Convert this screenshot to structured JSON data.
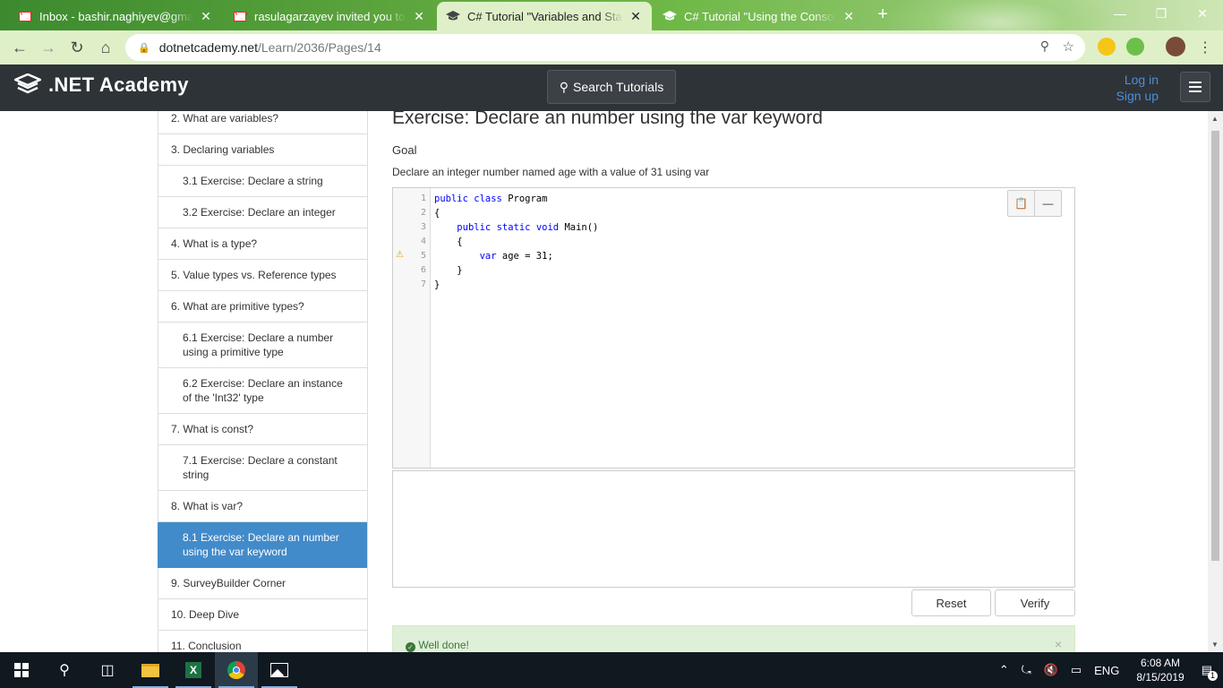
{
  "browser": {
    "tabs": [
      {
        "title": "Inbox - bashir.naghiyev@gmail.com",
        "icon": "gmail-icon",
        "active": false
      },
      {
        "title": "rasulagarzayev invited you to Co",
        "icon": "gmail-icon",
        "active": false
      },
      {
        "title": "C# Tutorial \"Variables and Standa",
        "icon": "graduation-cap-icon",
        "active": true
      },
      {
        "title": "C# Tutorial \"Using the Console\" -",
        "icon": "graduation-cap-icon",
        "active": false
      }
    ],
    "url_host": "dotnetcademy.net",
    "url_path": "/Learn/2036/Pages/14"
  },
  "header": {
    "logo_text": ".NET Academy",
    "search_label": "Search Tutorials",
    "login_label": "Log in",
    "signup_label": "Sign up"
  },
  "sidebar": {
    "items": [
      {
        "label": "2. What are variables?",
        "sub": false,
        "active": false
      },
      {
        "label": "3. Declaring variables",
        "sub": false,
        "active": false
      },
      {
        "label": "3.1 Exercise: Declare a string",
        "sub": true,
        "active": false
      },
      {
        "label": "3.2 Exercise: Declare an integer",
        "sub": true,
        "active": false
      },
      {
        "label": "4. What is a type?",
        "sub": false,
        "active": false
      },
      {
        "label": "5. Value types vs. Reference types",
        "sub": false,
        "active": false
      },
      {
        "label": "6. What are primitive types?",
        "sub": false,
        "active": false
      },
      {
        "label": "6.1 Exercise: Declare a number using a primitive type",
        "sub": true,
        "active": false
      },
      {
        "label": "6.2 Exercise: Declare an instance of the 'Int32' type",
        "sub": true,
        "active": false
      },
      {
        "label": "7. What is const?",
        "sub": false,
        "active": false
      },
      {
        "label": "7.1 Exercise: Declare a constant string",
        "sub": true,
        "active": false
      },
      {
        "label": "8. What is var?",
        "sub": false,
        "active": false
      },
      {
        "label": "8.1 Exercise: Declare an number using the var keyword",
        "sub": true,
        "active": true
      },
      {
        "label": "9. SurveyBuilder Corner",
        "sub": false,
        "active": false
      },
      {
        "label": "10. Deep Dive",
        "sub": false,
        "active": false
      },
      {
        "label": "11. Conclusion",
        "sub": false,
        "active": false
      }
    ]
  },
  "exercise": {
    "title": "Exercise: Declare an number using the var keyword",
    "goal_heading": "Goal",
    "goal_text": "Declare an integer number named age with a value of 31 using var",
    "code_lines": [
      {
        "n": "1",
        "text": "public class Program"
      },
      {
        "n": "2",
        "text": "{"
      },
      {
        "n": "3",
        "text": "    public static void Main()"
      },
      {
        "n": "4",
        "text": "    {"
      },
      {
        "n": "5",
        "text": "        var age = 31;"
      },
      {
        "n": "6",
        "text": "    }"
      },
      {
        "n": "7",
        "text": "}"
      }
    ],
    "reset_label": "Reset",
    "verify_label": "Verify",
    "success_message": "Well done!"
  },
  "taskbar": {
    "apps": [
      "windows-start-icon",
      "search-icon",
      "task-view-icon",
      "file-explorer-icon",
      "excel-icon",
      "chrome-icon",
      "photos-icon"
    ],
    "language": "ENG",
    "time": "6:08 AM",
    "date": "8/15/2019",
    "notification_count": "1"
  },
  "colors": {
    "header_bg": "#2e3338",
    "active_item": "#428bca",
    "success_bg": "#dff0d8",
    "link": "#4a90d9"
  }
}
